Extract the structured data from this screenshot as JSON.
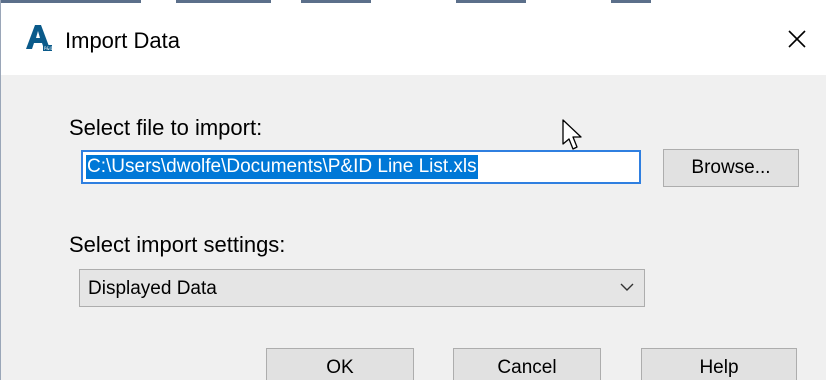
{
  "window": {
    "title": "Import Data",
    "app_icon": "autocad-plant-icon",
    "close_icon": "close-icon"
  },
  "file_section": {
    "label": "Select file to import:",
    "file_path": "C:\\Users\\dwolfe\\Documents\\P&ID Line List.xls",
    "browse_label": "Browse..."
  },
  "settings_section": {
    "label": "Select import settings:",
    "selected_value": "Displayed Data",
    "dropdown_icon": "chevron-down-icon"
  },
  "footer": {
    "ok_label": "OK",
    "cancel_label": "Cancel",
    "help_label": "Help"
  },
  "colors": {
    "accent": "#0078d7",
    "dialog_background": "#f0f0f0",
    "title_background": "#ffffff"
  }
}
